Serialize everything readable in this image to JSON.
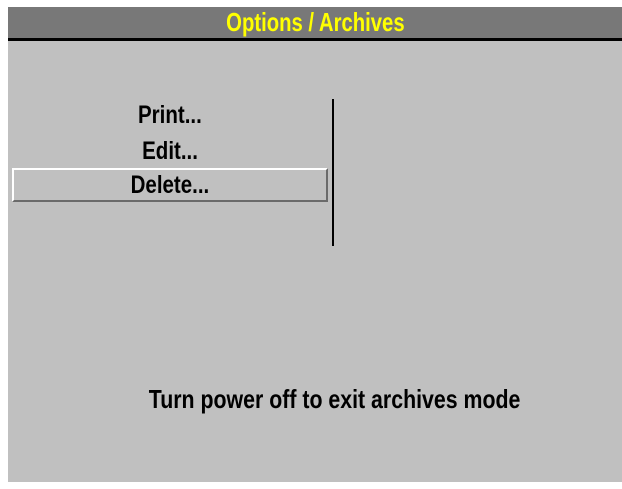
{
  "title_bar": {
    "title": "Options / Archives"
  },
  "menu": {
    "items": [
      {
        "label": "Print...",
        "selected": false
      },
      {
        "label": "Edit...",
        "selected": false
      },
      {
        "label": "Delete...",
        "selected": true
      }
    ]
  },
  "footer": {
    "message": "Turn power off to exit archives mode"
  },
  "colors": {
    "background": "#c0c0c0",
    "title_bar_bg": "#787878",
    "title_text": "#ffff00",
    "text": "#000000"
  }
}
